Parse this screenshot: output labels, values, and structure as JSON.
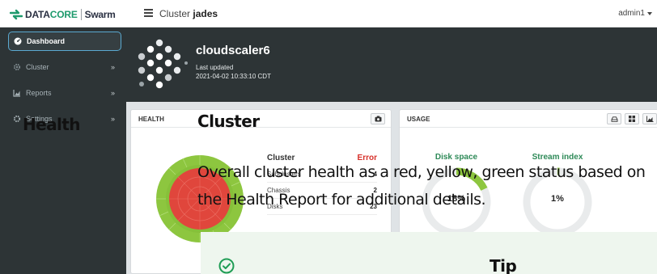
{
  "topbar": {
    "brand_data": "DATA",
    "brand_core": "CORE",
    "brand_product": "Swarm",
    "breadcrumb_prefix": "Cluster",
    "breadcrumb_name": "jades",
    "user": "admin1"
  },
  "sidebar": {
    "items": [
      {
        "label": "Dashboard",
        "icon": "dashboard-icon",
        "active": true
      },
      {
        "label": "Cluster",
        "icon": "cluster-gear-icon",
        "chevron": "»"
      },
      {
        "label": "Reports",
        "icon": "reports-chart-icon",
        "chevron": "»"
      },
      {
        "label": "Settings",
        "icon": "settings-icon",
        "chevron": "»"
      }
    ]
  },
  "cluster": {
    "name": "cloudscaler6",
    "updated_label": "Last updated",
    "updated_time": "2021-04-02 10:33:10 CDT"
  },
  "health_panel": {
    "title": "HEALTH",
    "header_col": "Cluster",
    "status": "Error",
    "rows": [
      {
        "label": "Subclusters",
        "value": "4"
      },
      {
        "label": "Chassis",
        "value": "2"
      },
      {
        "label": "Disks",
        "value": "23"
      }
    ]
  },
  "usage_panel": {
    "title": "USAGE",
    "disk_space_label": "Disk space",
    "disk_space_value": "18%",
    "stream_index_label": "Stream index",
    "stream_index_value": "1%"
  },
  "help": {
    "section_title": "Health",
    "topic_title": "Cluster",
    "line1": "Overall cluster health as a red, yellow, green status based on",
    "line2": "the Health Report for additional details.",
    "tip_title": "Tip"
  },
  "colors": {
    "sidebar_bg": "#2d3436",
    "accent_green": "#1d9a6c",
    "error_red": "#d7302a",
    "health_green": "#8dc63f",
    "health_red": "#e0463c"
  }
}
